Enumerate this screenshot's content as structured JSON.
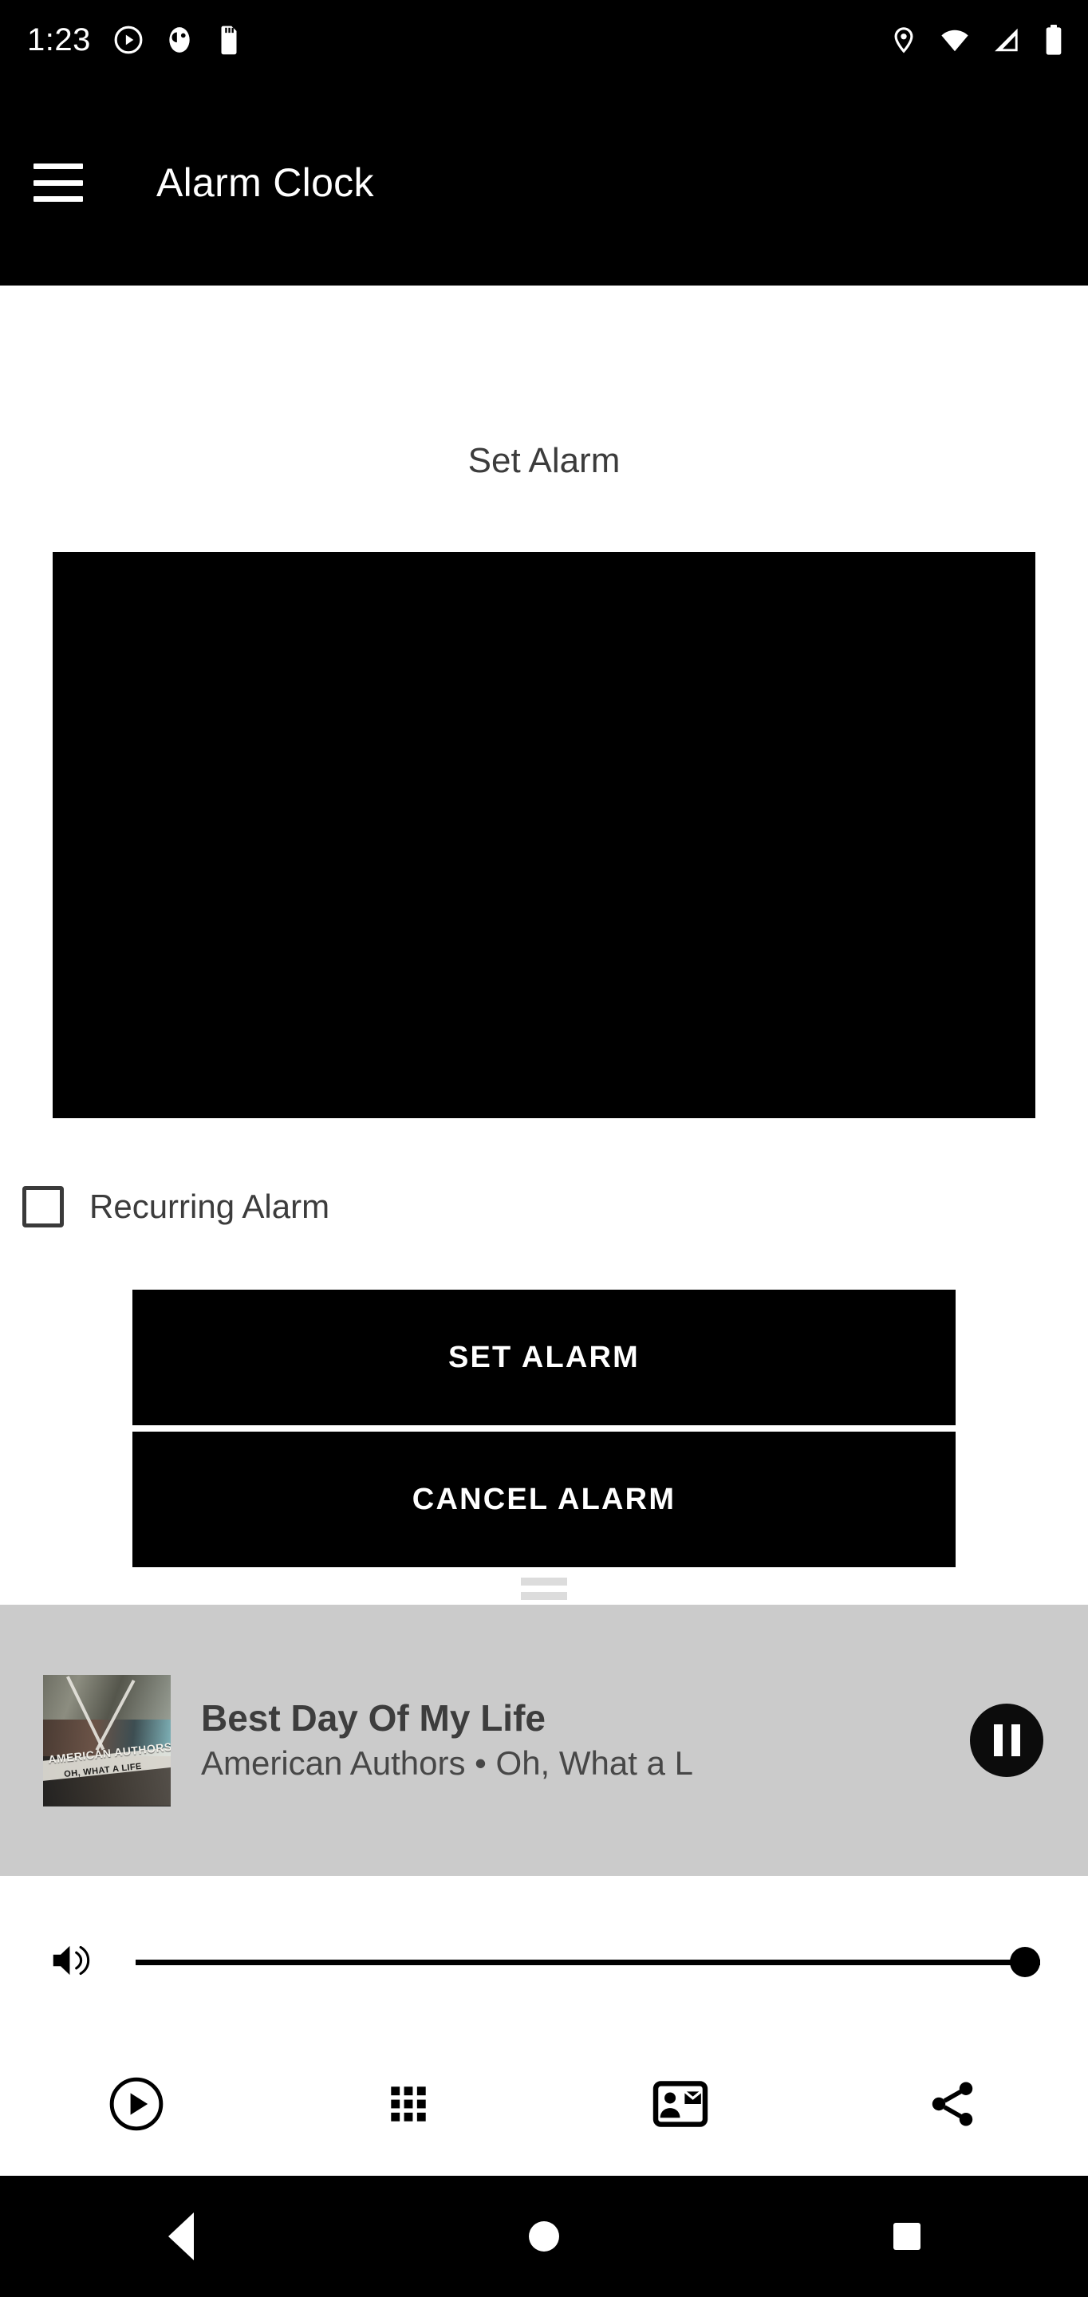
{
  "status_bar": {
    "clock": "1:23",
    "left_icons": [
      "play-circle-icon",
      "app-badge-icon",
      "sd-card-icon"
    ],
    "right_icons": [
      "location-pin-icon",
      "wifi-icon",
      "cellular-signal-icon",
      "battery-icon"
    ]
  },
  "app_bar": {
    "menu_icon": "hamburger-menu-icon",
    "title": "Alarm Clock"
  },
  "main": {
    "section_title": "Set Alarm",
    "time_picker_placeholder": "",
    "recurring": {
      "label": "Recurring Alarm",
      "checked": false
    },
    "buttons": {
      "set": "SET ALARM",
      "cancel": "CANCEL ALARM"
    }
  },
  "media_player": {
    "drag_handle": "drag-handle-icon",
    "album_art": {
      "line1": "AMERICAN AUTHORS",
      "line2": "OH, WHAT A LIFE"
    },
    "title": "Best Day Of My Life",
    "subtitle": "American Authors • Oh, What a L",
    "playback_state": "playing",
    "playback_icon": "pause-icon"
  },
  "volume": {
    "icon": "volume-up-icon",
    "level": 100
  },
  "icon_row": [
    {
      "name": "play-circle-icon"
    },
    {
      "name": "apps-grid-icon"
    },
    {
      "name": "contact-mail-icon"
    },
    {
      "name": "share-icon"
    }
  ],
  "nav_bar": {
    "back": "back-triangle-icon",
    "home": "home-circle-icon",
    "recents": "recents-square-icon"
  },
  "colors": {
    "app_bar_bg": "#000000",
    "page_bg": "#ffffff",
    "media_panel_bg": "#cbcbcb",
    "button_bg": "#000000",
    "button_text": "#ffffff"
  }
}
